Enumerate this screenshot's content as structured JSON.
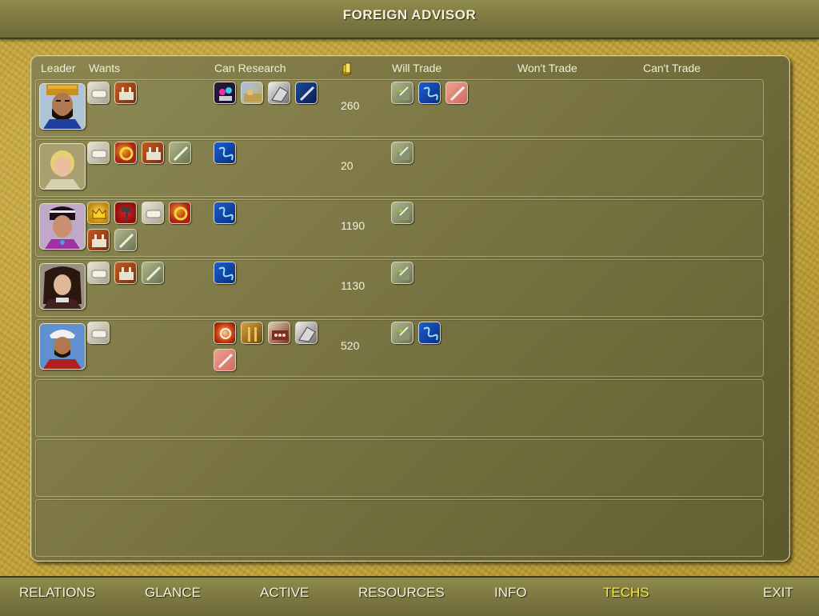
{
  "title": "FOREIGN ADVISOR",
  "headers": {
    "leader": "Leader",
    "wants": "Wants",
    "can_research": "Can Research",
    "will_trade": "Will Trade",
    "wont_trade": "Won't Trade",
    "cant_trade": "Can't Trade"
  },
  "gold_icon": "gold-coins-icon",
  "rows": [
    {
      "leader_portrait": "persian-leader-portrait",
      "wants": [
        "writing-icon",
        "construction-icon"
      ],
      "can_research": [
        "philosophy-icon",
        "currency-icon",
        "iron-working-icon",
        "mathematics-icon"
      ],
      "gold": "260",
      "will_trade": [
        "pottery-icon",
        "electricity-icon",
        "medicine-icon"
      ]
    },
    {
      "leader_portrait": "greek-leader-portrait",
      "wants": [
        "writing-icon",
        "bronze-working-icon",
        "construction-icon",
        "mathematics-icon"
      ],
      "can_research": [
        "electricity-icon"
      ],
      "gold": "20",
      "will_trade": [
        "pottery-icon"
      ]
    },
    {
      "leader_portrait": "indian-leader-portrait",
      "wants": [
        "monarchy-icon",
        "masonry-icon",
        "writing-icon",
        "bronze-working-icon",
        "construction-icon",
        "mathematics-icon"
      ],
      "can_research": [
        "electricity-icon"
      ],
      "gold": "1190",
      "will_trade": [
        "pottery-icon"
      ]
    },
    {
      "leader_portrait": "french-leader-portrait",
      "wants": [
        "writing-icon",
        "construction-icon",
        "mathematics-icon"
      ],
      "can_research": [
        "electricity-icon"
      ],
      "gold": "1130",
      "will_trade": [
        "pottery-icon"
      ]
    },
    {
      "leader_portrait": "arab-leader-portrait",
      "wants": [
        "writing-icon"
      ],
      "can_research": [
        "the-wheel-icon",
        "philosophy-icon",
        "mill-icon",
        "iron-working-icon",
        "medicine-icon"
      ],
      "gold": "520",
      "will_trade": [
        "pottery-icon",
        "electricity-icon"
      ]
    }
  ],
  "nav": [
    {
      "label": "RELATIONS",
      "active": false
    },
    {
      "label": "GLANCE",
      "active": false
    },
    {
      "label": "ACTIVE",
      "active": false
    },
    {
      "label": "RESOURCES",
      "active": false
    },
    {
      "label": "INFO",
      "active": false
    },
    {
      "label": "TECHS",
      "active": true
    },
    {
      "label": "EXIT",
      "active": false
    }
  ],
  "colors": {
    "active_tab": "#f6e840",
    "text": "#f4f1dc",
    "panel": "#7a7541",
    "background": "#bfa13c"
  }
}
